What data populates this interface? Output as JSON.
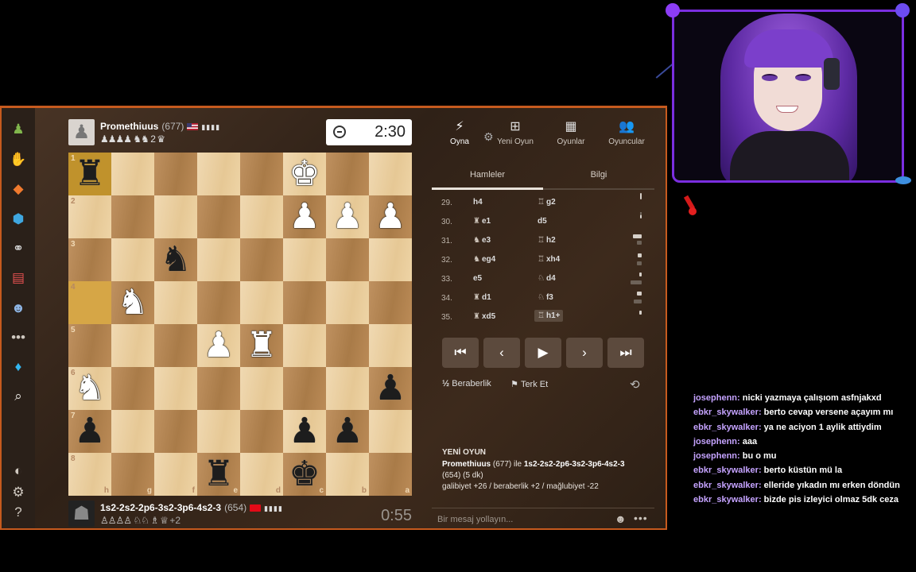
{
  "sidebar": {
    "icons": [
      "pawn-play-icon",
      "hand-puzzle-icon",
      "learn-icon",
      "cube-watch-icon",
      "binoculars-icon",
      "news-icon",
      "social-icon",
      "more-icon",
      "diamond-icon",
      "search-icon",
      "theme-icon",
      "settings-icon",
      "help-icon"
    ]
  },
  "top_player": {
    "name": "Promethiuus",
    "rating": "(677)",
    "signal": "▮▮▮▮",
    "captured": "♟♟♟♟ ♞♞ 2 ♛",
    "clock": "2:30"
  },
  "bottom_player": {
    "name": "1s2-2s2-2p6-3s2-3p6-4s2-3",
    "rating": "(654)",
    "signal": "▮▮▮▮",
    "captured": "♙♙♙♙ ♘♘ ♗ ♕",
    "extra": "+2",
    "clock": "0:55"
  },
  "board": {
    "rank_labels": {
      "0": "1",
      "8": "2",
      "16": "3",
      "24": "4",
      "32": "5",
      "40": "6",
      "48": "7",
      "56": "8"
    },
    "file_labels": [
      "h",
      "g",
      "f",
      "e",
      "d",
      "c",
      "b",
      "a"
    ],
    "highlight_squares": [
      0,
      24
    ],
    "pieces": {
      "0": {
        "glyph": "♜",
        "color": "black"
      },
      "5": {
        "glyph": "♚",
        "color": "white"
      },
      "13": {
        "glyph": "♟",
        "color": "white"
      },
      "14": {
        "glyph": "♟",
        "color": "white"
      },
      "15": {
        "glyph": "♟",
        "color": "white"
      },
      "18": {
        "glyph": "♞",
        "color": "black"
      },
      "25": {
        "glyph": "♞",
        "color": "white"
      },
      "35": {
        "glyph": "♟",
        "color": "white"
      },
      "36": {
        "glyph": "♜",
        "color": "white"
      },
      "40": {
        "glyph": "♞",
        "color": "white"
      },
      "47": {
        "glyph": "♟",
        "color": "black"
      },
      "48": {
        "glyph": "♟",
        "color": "black"
      },
      "53": {
        "glyph": "♟",
        "color": "black"
      },
      "54": {
        "glyph": "♟",
        "color": "black"
      },
      "59": {
        "glyph": "♜",
        "color": "black"
      },
      "61": {
        "glyph": "♚",
        "color": "black"
      }
    }
  },
  "panel": {
    "tabs": [
      {
        "label": "Oyna",
        "icon": "⚡"
      },
      {
        "label": "Yeni Oyun",
        "icon": "⊞"
      },
      {
        "label": "Oyunlar",
        "icon": "▦"
      },
      {
        "label": "Oyuncular",
        "icon": "👥"
      }
    ],
    "subtabs": [
      "Hamleler",
      "Bilgi"
    ],
    "moves": [
      {
        "n": "29.",
        "w_fig": "",
        "w": "h4",
        "b_fig": "♖",
        "b": "g2"
      },
      {
        "n": "30.",
        "w_fig": "♜",
        "w": "e1",
        "b_fig": "",
        "b": "d5"
      },
      {
        "n": "31.",
        "w_fig": "♞",
        "w": "e3",
        "b_fig": "♖",
        "b": "h2"
      },
      {
        "n": "32.",
        "w_fig": "♞",
        "w": "eg4",
        "b_fig": "♖",
        "b": "xh4"
      },
      {
        "n": "33.",
        "w_fig": "",
        "w": "e5",
        "b_fig": "♘",
        "b": "d4"
      },
      {
        "n": "34.",
        "w_fig": "♜",
        "w": "d1",
        "b_fig": "♘",
        "b": "f3"
      },
      {
        "n": "35.",
        "w_fig": "♜",
        "w": "xd5",
        "b_fig": "♖",
        "b": "h1+"
      }
    ],
    "nav": [
      "⏮",
      "‹",
      "▶",
      "›",
      "⏭"
    ],
    "draw_label": "Beraberlik",
    "draw_icon": "½",
    "resign_label": "Terk Et",
    "resign_icon": "⚑",
    "new_game": {
      "title": "YENİ OYUN",
      "white": "Promethiuus",
      "white_rating": "(677) ile",
      "black": "1s2-2s2-2p6-3s2-3p6-4s2-3",
      "tail": "(654) (5 dk)",
      "outcome": "galibiyet +26 / beraberlik +2 / mağlubiyet -22"
    },
    "message_placeholder": "Bir mesaj yollayın..."
  },
  "chat": [
    {
      "user": "josephenn:",
      "text": "nicki yazmaya çalışıom asfnjakxd"
    },
    {
      "user": "ebkr_skywalker:",
      "text": "berto cevap versene açayım mı"
    },
    {
      "user": "ebkr_skywalker:",
      "text": "ya ne aciyon 1 aylik attiydim"
    },
    {
      "user": "josephenn:",
      "text": "aaa"
    },
    {
      "user": "josephenn:",
      "text": "bu o mu"
    },
    {
      "user": "ebkr_skywalker:",
      "text": "berto küstün mü la"
    },
    {
      "user": "ebkr_skywalker:",
      "text": "elleride yıkadın mı erken döndün"
    },
    {
      "user": "ebkr_skywalker:",
      "text": "bizde pis izleyici olmaz 5dk ceza"
    }
  ],
  "colors": {
    "accent": "#c65a1e",
    "cam_border": "#7b2ee0",
    "chat_user": "#c5a3ff"
  }
}
